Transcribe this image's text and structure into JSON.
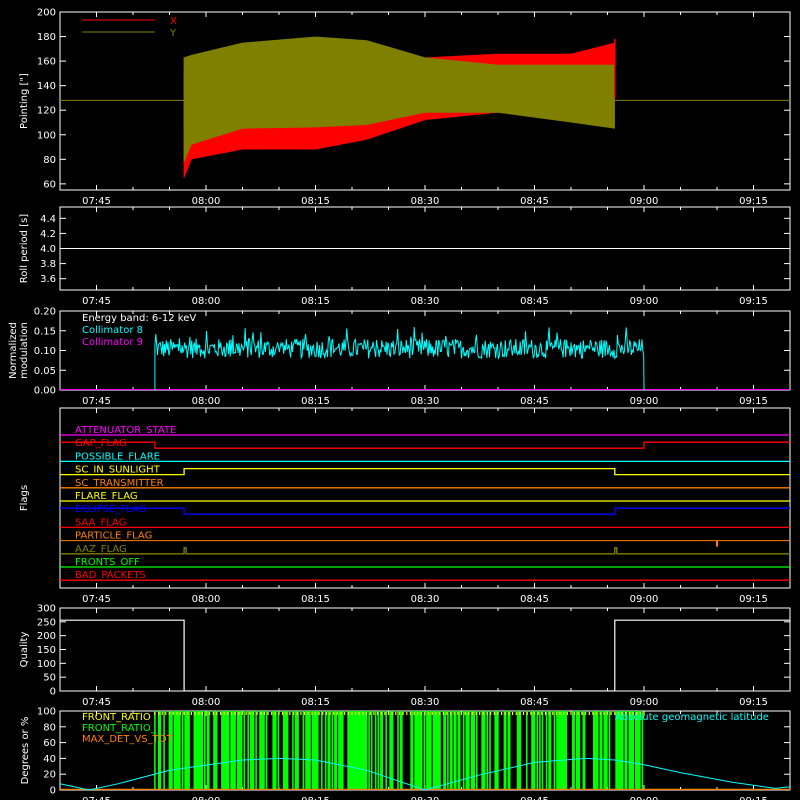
{
  "chart_data": [
    {
      "type": "line",
      "ylabel": "Pointing [\"]",
      "ylim": [
        55,
        200
      ],
      "yticks": [
        60,
        80,
        100,
        120,
        140,
        160,
        180,
        200
      ],
      "xticks": [
        "07:45",
        "08:00",
        "08:15",
        "08:30",
        "08:45",
        "09:00",
        "09:15"
      ],
      "legend": {
        "placement": "top-left",
        "entries": [
          "X",
          "Y"
        ]
      },
      "series": [
        {
          "name": "X",
          "color": "#ff0000",
          "x": [
            "07:57",
            "07:58",
            "08:05",
            "08:15",
            "08:22",
            "08:30",
            "08:40",
            "08:50",
            "08:56"
          ],
          "y_min": [
            65,
            80,
            88,
            88,
            96,
            112,
            118,
            112,
            105
          ],
          "y_max": [
            150,
            158,
            165,
            168,
            170,
            163,
            166,
            166,
            175
          ]
        },
        {
          "name": "Y",
          "color": "#808000",
          "x": [
            "07:57",
            "07:58",
            "08:05",
            "08:15",
            "08:22",
            "08:30",
            "08:40",
            "08:50",
            "08:56"
          ],
          "y_min": [
            78,
            92,
            105,
            106,
            108,
            118,
            118,
            110,
            105
          ],
          "y_max": [
            163,
            165,
            175,
            180,
            177,
            163,
            157,
            157,
            157
          ]
        }
      ],
      "baseline": {
        "value": 128,
        "color": "#808000"
      }
    },
    {
      "type": "line",
      "ylabel": "Roll period [s]",
      "ylim": [
        3.45,
        4.55
      ],
      "yticks": [
        3.6,
        3.8,
        4.0,
        4.2,
        4.4
      ],
      "xticks": [
        "07:45",
        "08:00",
        "08:15",
        "08:30",
        "08:45",
        "09:00",
        "09:15"
      ],
      "series": [
        {
          "color": "#ffffff",
          "x": [
            "07:40",
            "09:20"
          ],
          "y": [
            4.0,
            4.0
          ]
        }
      ]
    },
    {
      "type": "line",
      "ylabel": "Normalized modulation",
      "ylim": [
        0,
        0.2
      ],
      "yticks": [
        0.0,
        0.05,
        0.1,
        0.15,
        0.2
      ],
      "xticks": [
        "07:45",
        "08:00",
        "08:15",
        "08:30",
        "08:45",
        "09:00",
        "09:15"
      ],
      "annotation": "Energy band: 6-12 keV",
      "legend": {
        "placement": "top-left",
        "entries": [
          "Collimator 8",
          "Collimator 9"
        ]
      },
      "series": [
        {
          "name": "Collimator 8",
          "color": "#00ffff",
          "x_start": "07:53",
          "x_end": "09:00",
          "center": 0.105,
          "spread": 0.025
        },
        {
          "name": "Collimator 9",
          "color": "#ff00ff",
          "x": [
            "07:40",
            "09:20"
          ],
          "y": [
            0,
            0
          ]
        }
      ]
    },
    {
      "type": "line",
      "ylabel": "Flags",
      "xticks": [
        "07:45",
        "08:00",
        "08:15",
        "08:30",
        "08:45",
        "09:00",
        "09:15"
      ],
      "flags": [
        {
          "name": "ATTENUATOR_STATE",
          "color": "#ff00ff",
          "segments": []
        },
        {
          "name": "GAP_FLAG",
          "color": "#ff0000",
          "segments": [
            [
              "07:53",
              "09:00"
            ]
          ]
        },
        {
          "name": "POSSIBLE_FLARE",
          "color": "#00ffff",
          "segments": []
        },
        {
          "name": "SC_IN_SUNLIGHT",
          "color": "#ffff00",
          "segments": [
            [
              "07:57",
              "08:56"
            ]
          ]
        },
        {
          "name": "SC_TRANSMITTER",
          "color": "#ff8000",
          "segments": []
        },
        {
          "name": "FLARE_FLAG",
          "color": "#ffff00",
          "segments": []
        },
        {
          "name": "ECLIPSE_FLAG",
          "color": "#0000ff",
          "segments": [
            [
              "07:40",
              "07:57"
            ],
            [
              "08:56",
              "09:20"
            ]
          ]
        },
        {
          "name": "SAA_FLAG",
          "color": "#ff0000",
          "segments": []
        },
        {
          "name": "PARTICLE_FLAG",
          "color": "#ff8000",
          "segments": [
            [
              "09:10",
              "09:10"
            ]
          ]
        },
        {
          "name": "AAZ_FLAG",
          "color": "#808000",
          "segments": [
            [
              "07:57",
              "07:57"
            ],
            [
              "08:56",
              "08:56"
            ]
          ]
        },
        {
          "name": "FRONTS_OFF",
          "color": "#00ff00",
          "segments": []
        },
        {
          "name": "BAD_PACKETS",
          "color": "#ff0000",
          "segments": []
        }
      ]
    },
    {
      "type": "line",
      "ylabel": "Quality",
      "ylim": [
        0,
        300
      ],
      "yticks": [
        0,
        50,
        100,
        150,
        200,
        250,
        300
      ],
      "xticks": [
        "07:45",
        "08:00",
        "08:15",
        "08:30",
        "08:45",
        "09:00",
        "09:15"
      ],
      "series": [
        {
          "color": "#ffffff",
          "x": [
            "07:40",
            "07:57",
            "07:57",
            "08:56",
            "08:56",
            "09:20"
          ],
          "y": [
            256,
            256,
            0,
            0,
            256,
            256
          ]
        }
      ]
    },
    {
      "type": "line",
      "ylabel": "Degrees or %",
      "ylim": [
        0,
        100
      ],
      "yticks": [
        0,
        20,
        40,
        60,
        80,
        100
      ],
      "xticks": [
        "07:45",
        "08:00",
        "08:15",
        "08:30",
        "08:45",
        "09:00",
        "09:15"
      ],
      "legend": {
        "placement": "top-left",
        "entries": [
          "FRONT_RATIO",
          "FRONT_RATIO_",
          "MAX_DET_VS_TOT"
        ]
      },
      "annotation": "Absolute geomagnetic latitude",
      "series": [
        {
          "name": "FRONT_RATIO",
          "color": "#ffff00",
          "x_start": "07:53",
          "x_end": "09:00",
          "value": 100
        },
        {
          "name": "FRONT_RATIO_",
          "color": "#00ff00",
          "x_start": "07:53",
          "x_end": "09:00",
          "value": 100
        },
        {
          "name": "MAX_DET_VS_TOT",
          "color": "#ff8000",
          "x": [
            "07:40",
            "09:20"
          ],
          "y": [
            0,
            0
          ]
        },
        {
          "name": "Absolute geomagnetic latitude",
          "color": "#00ffff",
          "x": [
            "07:40",
            "07:44",
            "07:48",
            "07:55",
            "08:05",
            "08:10",
            "08:15",
            "08:22",
            "08:30",
            "08:37",
            "08:45",
            "08:52",
            "08:56",
            "09:00",
            "09:05",
            "09:12",
            "09:18",
            "09:20"
          ],
          "y": [
            8,
            0,
            8,
            25,
            38,
            40,
            38,
            25,
            0,
            18,
            35,
            40,
            38,
            32,
            22,
            10,
            2,
            4
          ]
        }
      ]
    }
  ]
}
